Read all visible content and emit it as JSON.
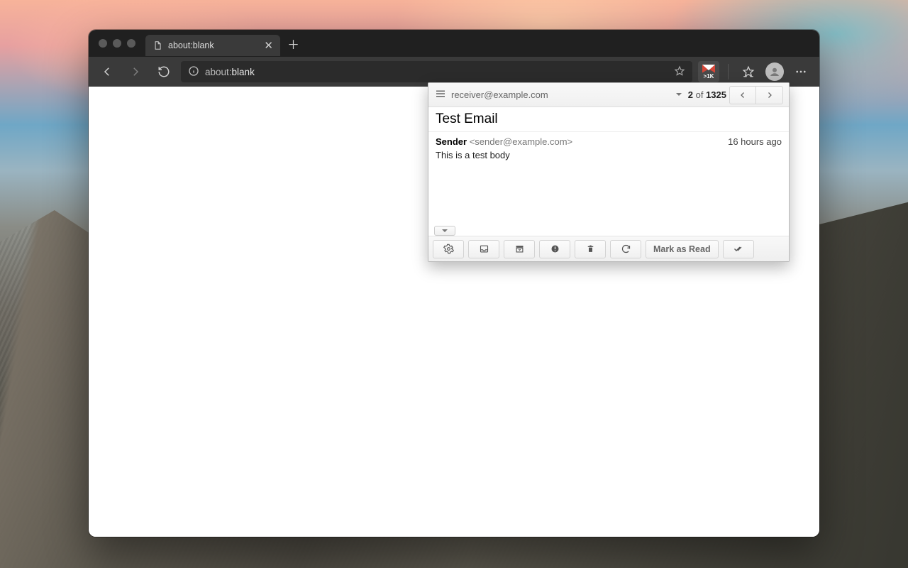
{
  "browser": {
    "tab_title": "about:blank",
    "url_prefix": "about:",
    "url_rest": "blank",
    "extension_badge": ">1K"
  },
  "popup": {
    "account": "receiver@example.com",
    "counter_current": "2",
    "counter_sep": " of ",
    "counter_total": "1325",
    "subject": "Test Email",
    "sender_name": "Sender",
    "sender_email": " <sender@example.com>",
    "time": "16 hours ago",
    "body": "This is a test body",
    "mark_as_read_label": "Mark as Read"
  }
}
